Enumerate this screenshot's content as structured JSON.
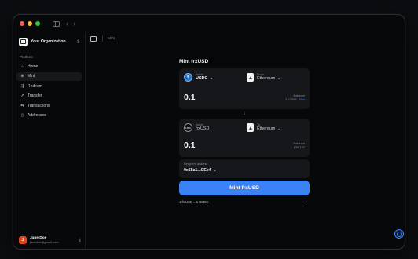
{
  "window": {
    "title": ""
  },
  "titlebar": {
    "back_icon": "chevron-left-icon",
    "forward_icon": "chevron-right-icon"
  },
  "sidebar": {
    "org_name": "Your Organization",
    "section_label": "Platform",
    "items": [
      {
        "label": "Home",
        "icon": "home-icon",
        "glyph": "⌂"
      },
      {
        "label": "Mint",
        "icon": "mint-icon",
        "glyph": "⊕"
      },
      {
        "label": "Redeem",
        "icon": "redeem-icon",
        "glyph": "⇶"
      },
      {
        "label": "Transfer",
        "icon": "send-icon",
        "glyph": "➚"
      },
      {
        "label": "Transactions",
        "icon": "transactions-icon",
        "glyph": "⇆"
      },
      {
        "label": "Addresses",
        "icon": "addresses-icon",
        "glyph": "▯"
      }
    ],
    "user": {
      "initial": "J",
      "name": "Jane Doe",
      "email": "janedoe@gmail.com"
    }
  },
  "header": {
    "breadcrumb": "Mint"
  },
  "mint": {
    "title": "Mint frxUSD",
    "from_card": {
      "asset_label": "Asset",
      "asset_value": "USDC",
      "network_label": "From",
      "network_value": "Ethereum",
      "amount": "0.1",
      "balance_label": "Balance",
      "balance_value": "1.67008",
      "max_label": "Max"
    },
    "to_card": {
      "asset_label": "Asset",
      "asset_value": "frxUSD",
      "coin_text": "USD",
      "network_label": "To",
      "network_value": "Ethereum",
      "amount": "0.1",
      "balance_label": "Balance",
      "balance_value": "138.132"
    },
    "recipient": {
      "label": "Recipient address",
      "address": "0x68a1...CEe4"
    },
    "mint_button": "Mint frxUSD",
    "rate": "1 frxUSD = 1 USDC"
  },
  "colors": {
    "accent": "#3b82f6",
    "avatar": "#e2441e",
    "usdc": "#2775ca"
  }
}
